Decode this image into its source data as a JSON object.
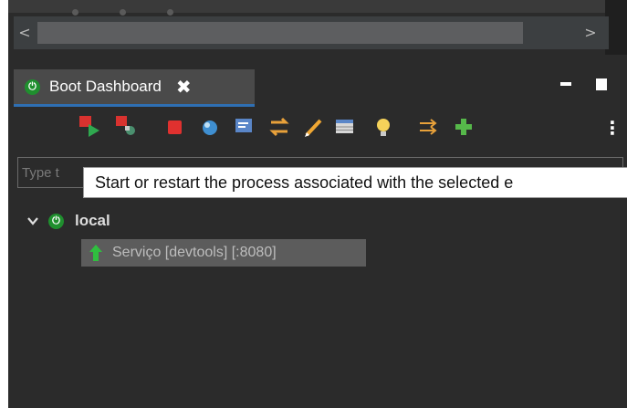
{
  "tab": {
    "title": "Boot Dashboard",
    "close_glyph": "✖"
  },
  "scrollbar": {
    "left_glyph": "<",
    "right_glyph": ">"
  },
  "toolbar": {
    "icons": [
      "start-restart-icon",
      "debug-icon",
      "stop-icon",
      "open-browser-icon",
      "open-console-icon",
      "link-icon",
      "edit-icon",
      "config-icon",
      "bulb-icon",
      "expose-icon",
      "add-icon"
    ],
    "menu_glyph": "⋮"
  },
  "filter": {
    "placeholder": "Type t"
  },
  "tooltip": {
    "text": "Start or restart the process associated with the selected e"
  },
  "tree": {
    "local": {
      "label": "local",
      "expanded_glyph": "⌄"
    },
    "service": {
      "label": "Serviço [devtools] [:8080]"
    }
  },
  "colors": {
    "background": "#2b2b2b",
    "accent": "#2f6fb3",
    "running_green": "#1f8f2e"
  }
}
